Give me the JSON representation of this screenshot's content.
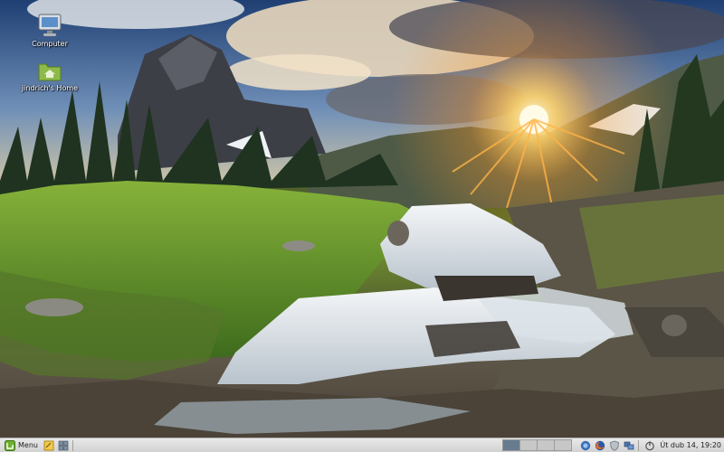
{
  "desktop": {
    "icons": [
      {
        "label": "Computer",
        "icon": "monitor-icon"
      },
      {
        "label": "jindrich's Home",
        "icon": "home-folder-icon"
      }
    ]
  },
  "panel": {
    "menu_label": "Menu",
    "launchers": [
      "notes-icon",
      "window-switcher-icon"
    ],
    "workspace_count": 4,
    "active_workspace": 1,
    "tray": [
      "pidgin-icon",
      "firefox-icon",
      "shield-icon",
      "network-icon"
    ],
    "clock_text": "Út dub 14, 19:20"
  },
  "colors": {
    "panel_bg": "#dcdcdc",
    "active_workspace": "#687c8f",
    "menu_accent": "#6fae32"
  }
}
